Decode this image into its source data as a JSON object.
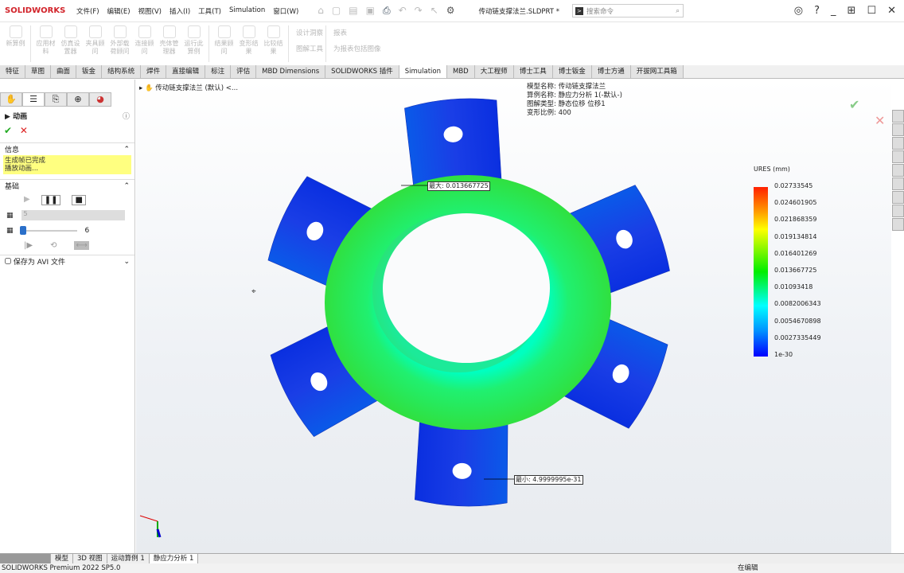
{
  "app": {
    "brand": "SOLIDWORKS",
    "doc_title": "传动链支撑法兰.SLDPRT *",
    "search_placeholder": "搜索命令"
  },
  "menu": [
    "文件(F)",
    "编辑(E)",
    "视图(V)",
    "插入(I)",
    "工具(T)",
    "Simulation",
    "窗口(W)"
  ],
  "commands": [
    "新算例",
    "应用材料",
    "仿真设置器",
    "夹具顾问",
    "外部载荷顾问",
    "连接顾问",
    "壳体管理器",
    "运行此算例",
    "结果顾问",
    "变形结果",
    "比较结果"
  ],
  "command_side": [
    "设计洞察",
    "图解工具",
    "报表",
    "为报表包括图像"
  ],
  "tabs": [
    "特征",
    "草图",
    "曲面",
    "钣金",
    "结构系统",
    "焊件",
    "直接编辑",
    "标注",
    "评估",
    "MBD Dimensions",
    "SOLIDWORKS 插件",
    "Simulation",
    "MBD",
    "大工程师",
    "博士工具",
    "博士钣金",
    "博士方通",
    "开拔网工具箱"
  ],
  "active_tab": "Simulation",
  "panel": {
    "title": "动画",
    "info_header": "信息",
    "info_lines": [
      "生成帧已完成",
      "播放动画..."
    ],
    "basic_header": "基础",
    "frames_value": "5",
    "speed_value": "6",
    "speed_fraction": 0.0,
    "save_avi": "保存为 AVI 文件",
    "save_avi_checked": false
  },
  "tree": {
    "root": "传动链支撑法兰 (默认) <..."
  },
  "info": {
    "model": "模型名称: 传动链支撑法兰",
    "study": "算例名称: 静应力分析 1(-默认-)",
    "plot": "图解类型: 静态位移 位移1",
    "scale": "变形比例: 400"
  },
  "legend": {
    "title": "URES (mm)",
    "labels": [
      "0.02733545",
      "0.024601905",
      "0.021868359",
      "0.019134814",
      "0.016401269",
      "0.013667725",
      "0.01093418",
      "0.0082006343",
      "0.0054670898",
      "0.0027335449",
      "1e-30"
    ]
  },
  "annotations": {
    "max": "最大: 0.013667725",
    "min": "最小: 4.9999995e-31"
  },
  "bottom_tabs": [
    "模型",
    "3D 视图",
    "运动算例 1",
    "静应力分析 1"
  ],
  "status": {
    "left": "SOLIDWORKS Premium 2022 SP5.0",
    "right": "在编辑"
  }
}
